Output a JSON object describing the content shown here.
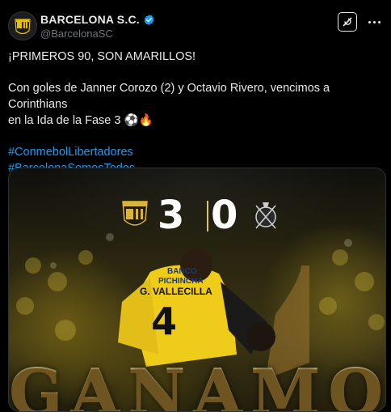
{
  "post": {
    "display_name": "BARCELONA S.C.",
    "handle": "@BarcelonaSC",
    "line1": "¡PRIMEROS 90, SON AMARILLOS!",
    "line2a": "Con goles de Janner Corozo (2) y Octavio Rivero, vencimos a Corinthians",
    "line2b": "en la Ida de la Fase 3 ⚽🔥",
    "hashtag1": "#ConmebolLibertadores",
    "hashtag2": "#BarcelonaSomosTodos"
  },
  "media": {
    "score_home": "3",
    "score_away": "0",
    "sponsor_line1": "BANCO",
    "sponsor_line2": "PICHINCHA",
    "player_name": "G. VALLECILLA",
    "player_number": "4",
    "headline": "GANAMOS"
  },
  "colors": {
    "accent_link": "#1d9bf0",
    "verified_badge": "#1d9bf0",
    "jersey_yellow": "#f2d21b",
    "gold_text": "#c9a24a"
  },
  "icons": {
    "verified": "verified-badge-icon",
    "grok": "grok-icon",
    "more": "more-dots-icon"
  }
}
